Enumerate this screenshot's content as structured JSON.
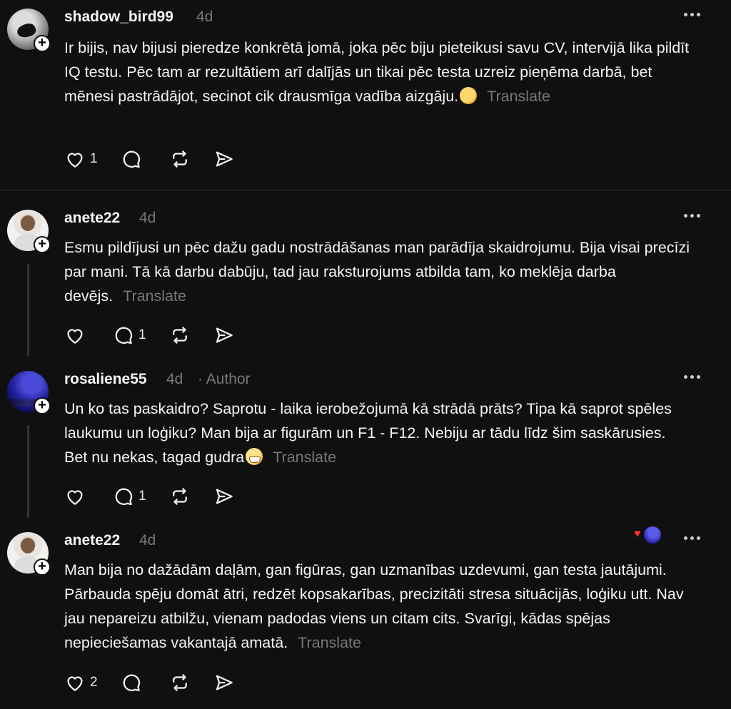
{
  "posts": [
    {
      "username": "shadow_bird99",
      "time": "4d",
      "text": "Ir bijis, nav bijusi pieredze konkrētā jomā, joka pēc biju pieteikusi savu CV, intervijā lika pildīt IQ testu. Pēc tam ar rezultātiem arī dalījās un tikai pēc testa uzreiz pieņēma darbā, bet mēnesi pastrādājot, secinot cik drausmīga vadība aizgāju.",
      "translate": "Translate",
      "likes": "1",
      "replies": ""
    },
    {
      "username": "anete22",
      "time": "4d",
      "text": "Esmu pildījusi un pēc dažu gadu nostrādāšanas man parādīja skaidrojumu. Bija visai precīzi par mani. Tā kā darbu dabūju, tad jau raksturojums atbilda tam, ko meklēja darba devējs.",
      "translate": "Translate",
      "likes": "",
      "replies": "1"
    },
    {
      "username": "rosaliene55",
      "time": "4d",
      "author": "· Author",
      "text": "Un ko tas paskaidro? Saprotu - laika ierobežojumā kā strādā prāts? Tipa kā saprot spēles laukumu un loģiku? Man bija ar figurām un F1 - F12. Nebiju ar tādu līdz šim saskārusies. Bet nu nekas, tagad gudra",
      "translate": "Translate",
      "likes": "",
      "replies": "1"
    },
    {
      "username": "anete22",
      "time": "4d",
      "text": "Man bija no dažādām daļām, gan figūras, gan uzmanības uzdevumi, gan testa jautājumi. Pārbauda spēju domāt ātri, redzēt kopsakarības, precizitāti stresa situācijās, loģiku utt. Nav jau nepareizu atbilžu, vienam padodas viens un citam cits. Svarīgi, kādas spējas nepieciešamas vakantajā amatā.",
      "translate": "Translate",
      "likes": "2",
      "replies": ""
    }
  ],
  "icons": {
    "like": "heart-icon",
    "reply": "comment-icon",
    "repost": "repost-icon",
    "share": "send-icon",
    "more": "more-icon",
    "follow": "plus-icon"
  },
  "colors": {
    "background": "#101010",
    "text": "#f3f5f7",
    "muted": "#777777",
    "reaction_heart": "#ff3040"
  }
}
